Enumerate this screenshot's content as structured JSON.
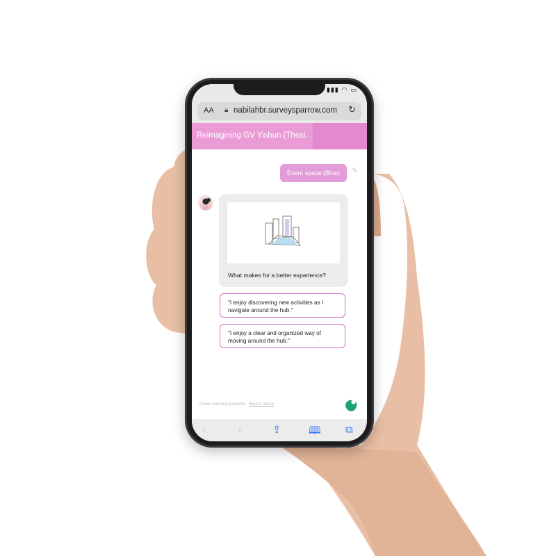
{
  "browser": {
    "text_size_label": "AA",
    "url": "nabilahbr.surveysparrow.com",
    "icons": {
      "lock": "lock-icon",
      "reload": "reload-icon"
    }
  },
  "survey": {
    "title": "Reimagining GV Yishun (Thesi...",
    "previous_answer": "Event space (Blue)",
    "question": "What makes for a better experience?",
    "choices": [
      {
        "label": "\"I enjoy discovering new activities as I navigate around the hub.\""
      },
      {
        "label": "\"I enjoy a clear and organized way of moving around the hub.\""
      }
    ]
  },
  "footer": {
    "note": "Never submit passwords -",
    "link": "Report abuse"
  },
  "toolbar": {
    "items": [
      "back-icon",
      "forward-icon",
      "share-icon",
      "bookmarks-icon",
      "tabs-icon"
    ]
  },
  "colors": {
    "header": "#ea9bd6",
    "answer_bubble": "#e49bd9",
    "choice_border": "#d56fc9",
    "brand": "#1aa36f",
    "toolbar_icon": "#3478f6"
  }
}
